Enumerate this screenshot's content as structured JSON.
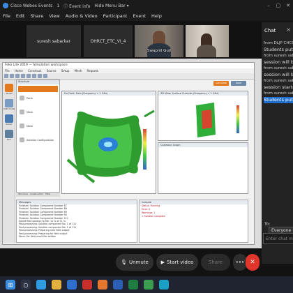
{
  "titlebar": {
    "app_name": "Cisco Webex Events",
    "notif_count": "1",
    "event_info": "Event info",
    "hide_menu_bar": "Hide Menu Bar",
    "minimize": "–",
    "maximize": "▢",
    "close": "✕"
  },
  "menu": [
    "File",
    "Edit",
    "Share",
    "View",
    "Audio & Video",
    "Participant",
    "Event",
    "Help"
  ],
  "participants": [
    {
      "name": "suresh sabarkar"
    },
    {
      "name": "OHRCT_ETC_VI_4"
    },
    {
      "name": "Swapnil Gujl"
    },
    {
      "name": ""
    }
  ],
  "chat": {
    "title": "Chat",
    "close": "×",
    "lines": [
      "from DLJP CHCO",
      "Students put yo",
      "from suresh sabar",
      "session will be",
      "from suresh sabar",
      "session will be",
      "from suresh sabar",
      "session started",
      "from suresh sabar",
      "Students put yo"
    ],
    "to_label": "To:",
    "to_value": "Everyone",
    "input_placeholder": "Enter chat me"
  },
  "app": {
    "title": "Feko Lite 2019 — Simulation workspace",
    "menu": [
      "File",
      "Home",
      "Construct",
      "Source",
      "Setup",
      "Mesh",
      "Request"
    ],
    "left_icons": [
      {
        "label": "Model",
        "color": "#e47a1e"
      },
      {
        "label": "CAD model",
        "color": "#7a9cc2"
      },
      {
        "label": "Solver",
        "color": "#4a7ab0"
      },
      {
        "label": "Run",
        "color": "#5f7f9d"
      }
    ],
    "structure": {
      "header": "Structure",
      "items": [
        "Ports",
        "Mesh",
        "Mesh",
        "Solution Configuration"
      ],
      "tabs": [
        "Structure",
        "Construction",
        "Filter"
      ]
    },
    "run_buttons": [
      {
        "label": "Calculate",
        "color": "#e47a1e"
      },
      {
        "label": "Save",
        "color": "#6d8aa8"
      }
    ],
    "view_a": "Far Field: Gain (Frequency = 1 GHz)",
    "view_b": "3D View: Surface Currents (Frequency = 1 GHz)",
    "view_c": "Cartesian Graph",
    "log": {
      "header": "Messages",
      "lines": [
        "Finished: Solution Component Number 87",
        "Finished: Solution Component Number 88",
        "Finished: Solution Component Number 89",
        "Finished: Solution Component Number 90",
        "Finished: Solution Component Number 111",
        "Saved field solution to file: 11 % of 11 %",
        "Post-processing: Solution component No. 1 of 111",
        "Post-processing: Solution component No. 1 of 111",
        "Post-processing: Preparing near field output",
        "Post-processing: Preparing far field output",
        "Done: Far field result file written"
      ]
    },
    "output": {
      "header": "Console",
      "lines": [
        "Status: Running",
        "Error: 0",
        "Warnings: 1",
        "> Solution complete"
      ]
    }
  },
  "controls": {
    "unmute": "Unmute",
    "start_video": "Start video",
    "share": "Share",
    "more": "•••",
    "leave": "✕"
  },
  "taskbar": [
    {
      "name": "start",
      "color": "#3c8dde"
    },
    {
      "name": "search",
      "color": "#2c3444"
    },
    {
      "name": "edge",
      "color": "#2f9be0"
    },
    {
      "name": "explorer",
      "color": "#e0b13c"
    },
    {
      "name": "mail",
      "color": "#2f6fd0"
    },
    {
      "name": "acrobat",
      "color": "#c9302c"
    },
    {
      "name": "firefox",
      "color": "#e6772e"
    },
    {
      "name": "word",
      "color": "#2b5fb3"
    },
    {
      "name": "excel",
      "color": "#1f7d43"
    },
    {
      "name": "chrome",
      "color": "#3a9d52"
    },
    {
      "name": "webex",
      "color": "#1aa0c4"
    }
  ]
}
